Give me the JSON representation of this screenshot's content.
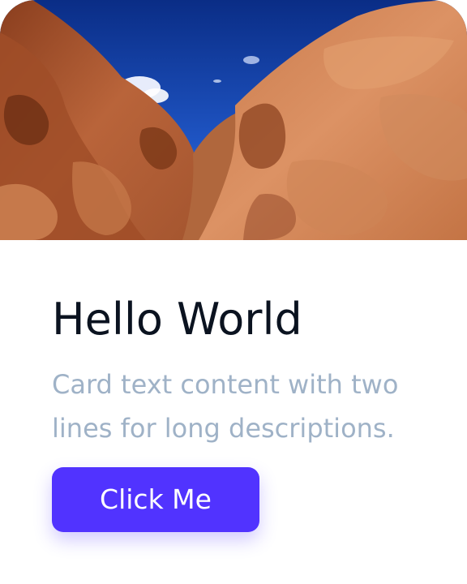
{
  "card": {
    "image": {
      "subject": "canyon-photo",
      "colors": {
        "sky_top": "#0a2d86",
        "sky_bottom": "#3a7de0",
        "rock_light": "#d98a5a",
        "rock_mid": "#b8663d",
        "rock_dark": "#7a3a1e"
      }
    },
    "title": "Hello World",
    "description": "Card text content with two lines for long descriptions.",
    "button_label": "Click Me",
    "colors": {
      "accent": "#5133ff",
      "title": "#0b1320",
      "description": "#9fb2c7",
      "background": "#ffffff"
    }
  }
}
